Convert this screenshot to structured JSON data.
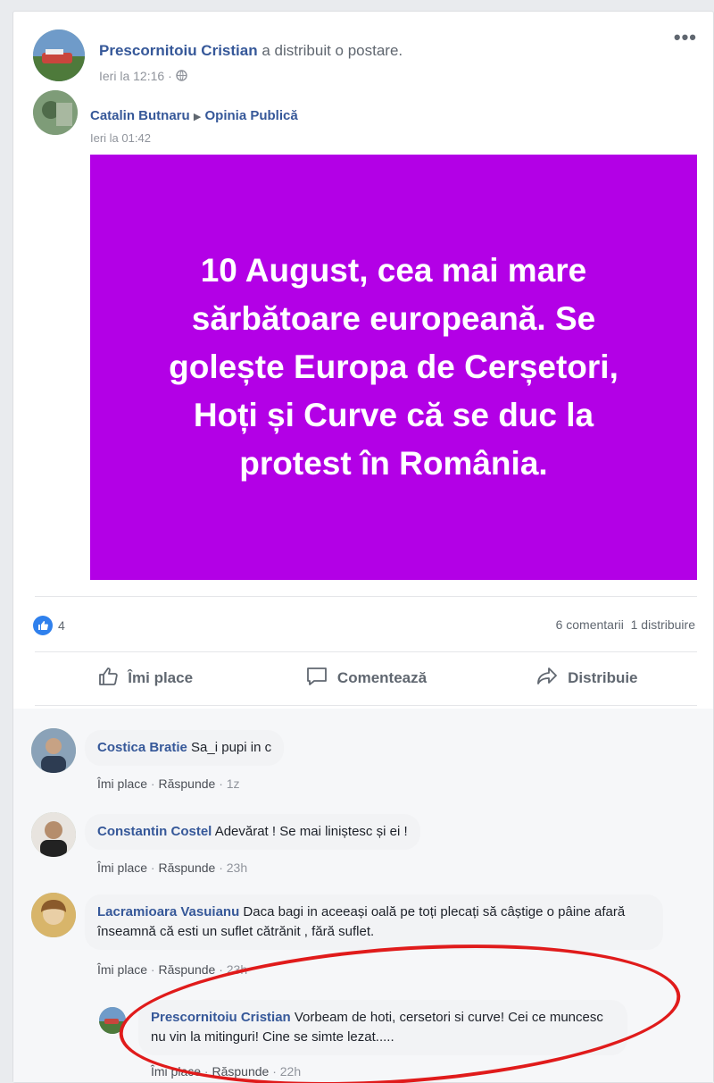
{
  "post": {
    "author": "Prescornitoiu Cristian",
    "action": "a distribuit o postare.",
    "time": "Ieri la 12:16",
    "separator": "·",
    "privacy_icon": "globe-icon",
    "more": "•••"
  },
  "shared": {
    "author": "Catalin Butnaru",
    "arrow": "▶",
    "group": "Opinia Publică",
    "time": "Ieri la 01:42",
    "image_text": "10 August, cea mai mare sărbătoare europeană. Se golește Europa de Cerșetori, Hoți și Curve că se duc la protest în România.",
    "image_color": "#b300e6"
  },
  "stats": {
    "like_count": "4",
    "comments": "6 comentarii",
    "shares": "1 distribuire"
  },
  "actions": {
    "like": "Îmi place",
    "comment": "Comentează",
    "share": "Distribuie"
  },
  "comments": [
    {
      "name": "Costica Bratie",
      "text": "Sa_i pupi in c",
      "like": "Îmi place",
      "reply": "Răspunde",
      "time": "1z"
    },
    {
      "name": "Constantin Costel",
      "text": "Adevărat ! Se mai liniștesc și ei !",
      "like": "Îmi place",
      "reply": "Răspunde",
      "time": "23h"
    },
    {
      "name": "Lacramioara Vasuianu",
      "text": "Daca bagi in aceeași oală pe toți plecați să câștige o pâine afară înseamnă că esti un suflet cătrănit , fără suflet.",
      "like": "Îmi place",
      "reply": "Răspunde",
      "time": "23h"
    }
  ],
  "reply": {
    "name": "Prescornitoiu Cristian",
    "text": "Vorbeam de hoti, cersetori si curve! Cei ce muncesc nu vin la mitinguri! Cine se simte lezat.....",
    "like": "Îmi place",
    "reply": "Răspunde",
    "time": "22h"
  },
  "colors": {
    "link": "#365899",
    "highlight": "#e01b1b",
    "like_blue": "#2f80ed"
  }
}
